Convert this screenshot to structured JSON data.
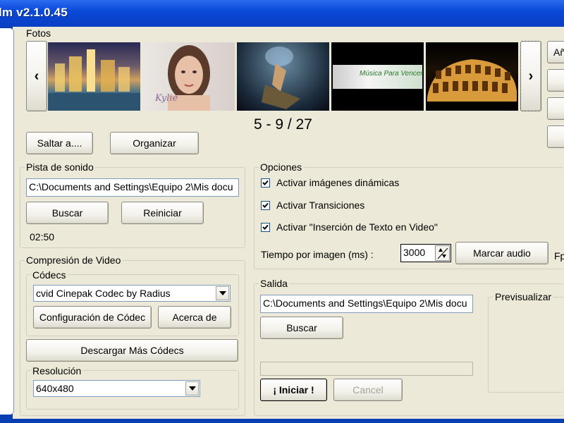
{
  "window": {
    "title": "lm v2.1.0.45"
  },
  "fotos": {
    "label": "Fotos",
    "prev": "‹",
    "next": "›",
    "counter": "5 - 9 / 27",
    "thumbnails": [
      {
        "name": "city-night"
      },
      {
        "name": "woman-portrait",
        "caption": "Kylie"
      },
      {
        "name": "fantasy-figure"
      },
      {
        "name": "banner",
        "caption": "Música Para Vencer"
      },
      {
        "name": "colosseum"
      }
    ],
    "jump_button": "Saltar a....",
    "organize_button": "Organizar"
  },
  "right_buttons": {
    "add_partial": "Añ"
  },
  "audio": {
    "label": "Pista de sonido",
    "path": "C:\\Documents and Settings\\Equipo 2\\Mis docu",
    "search": "Buscar",
    "reset": "Reiniciar",
    "duration": "02:50"
  },
  "compression": {
    "label": "Compresión de Video",
    "codecs_label": "Códecs",
    "codec_value": "cvid Cinepak Codec by Radius",
    "config_button": "Configuración de Códec",
    "about_button": "Acerca de",
    "download_button": "Descargar Más Códecs",
    "resolution_label": "Resolución",
    "resolution_value": "640x480"
  },
  "options": {
    "label": "Opciones",
    "dynamic_images": "Activar imágenes dinámicas",
    "transitions": "Activar Transiciones",
    "text_insertion": "Activar \"Inserción de Texto en Video\"",
    "time_label": "Tiempo por imagen (ms) :",
    "time_value": "3000",
    "mark_audio": "Marcar audio",
    "fps_partial": "Fp"
  },
  "output": {
    "label": "Salida",
    "path": "C:\\Documents and Settings\\Equipo 2\\Mis docu",
    "search": "Buscar",
    "progress": 0,
    "start": "¡ Iniciar !",
    "cancel": "Cancel"
  },
  "preview": {
    "label": "Previsualizar"
  }
}
